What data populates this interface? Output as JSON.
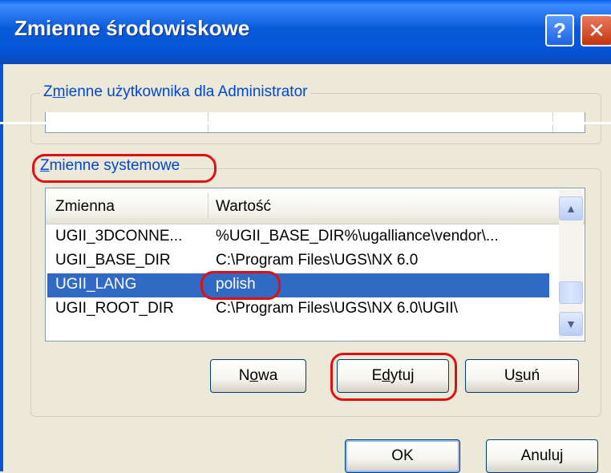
{
  "window": {
    "title": "Zmienne środowiskowe",
    "help_glyph": "?",
    "close_glyph": "✕"
  },
  "user_vars": {
    "label_prefix": "Z",
    "label_mnemonic": "m",
    "label_rest": "ienne użytkownika dla Administrator"
  },
  "system_vars": {
    "label_mnemonic": "Z",
    "label_rest": "mienne systemowe",
    "columns": [
      "Zmienna",
      "Wartość"
    ],
    "rows": [
      {
        "name": "UGII_3DCONNE...",
        "value": "%UGII_BASE_DIR%\\ugalliance\\vendor\\..."
      },
      {
        "name": "UGII_BASE_DIR",
        "value": "C:\\Program Files\\UGS\\NX 6.0"
      },
      {
        "name": "UGII_LANG",
        "value": "polish",
        "selected": true
      },
      {
        "name": "UGII_ROOT_DIR",
        "value": "C:\\Program Files\\UGS\\NX 6.0\\UGII\\"
      }
    ],
    "buttons": {
      "new": {
        "pre": "N",
        "mn": "o",
        "post": "wa"
      },
      "edit": {
        "pre": "E",
        "mn": "d",
        "post": "ytuj"
      },
      "delete": {
        "pre": "U",
        "mn": "s",
        "post": "uń"
      }
    }
  },
  "footer": {
    "ok": "OK",
    "cancel": "Anuluj"
  },
  "colors": {
    "title_bar": "#0554d6",
    "selection": "#316ac5",
    "annotation": "#e01010",
    "group_label": "#0046d5"
  },
  "icons": {
    "scroll_up": "chevron-up-icon",
    "scroll_down": "chevron-down-icon"
  }
}
